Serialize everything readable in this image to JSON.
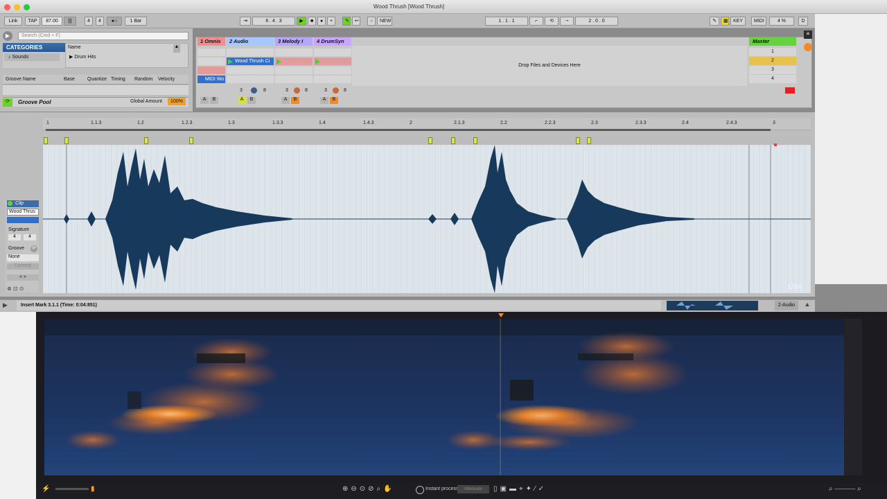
{
  "window": {
    "title": "Wood Thrush [Wood Thrush]"
  },
  "transport": {
    "link": "Link",
    "tap": "TAP",
    "tempo": "87.00",
    "signature_num": "4",
    "signature_den": "4",
    "quant": "1 Bar",
    "position": "6 . 4 . 3",
    "new": "NEW",
    "loop_start": "1 . 1 . 1",
    "loop_len": "2 . 0 . 0",
    "key": "KEY",
    "midi": "MIDI",
    "cpu": "4 %",
    "d": "D"
  },
  "browser": {
    "search_placeholder": "Search (Cmd + F)",
    "categories_label": "CATEGORIES",
    "sounds": "Sounds",
    "name_col": "Name",
    "drum_hits": "Drum Hits"
  },
  "groove": {
    "headers": [
      "Groove Name",
      "Base",
      "Quantize",
      "Timing",
      "Random",
      "Velocity"
    ],
    "pool": "Groove Pool",
    "global_amount_label": "Global Amount",
    "global_amount": "100%"
  },
  "session": {
    "tracks": [
      {
        "name": "1 Omnis",
        "color": "#ee8e8e"
      },
      {
        "name": "2 Audio",
        "color": "#a4c8ff"
      },
      {
        "name": "3 Melody I",
        "color": "#b7a6ff"
      },
      {
        "name": "4 DrumSyn",
        "color": "#c8a6ff"
      }
    ],
    "clip_wood": "Wood Thrush Ci",
    "clip_midi": "MIDI Wo",
    "drop_text": "Drop Files and Devices Here",
    "master": "Master",
    "scenes": [
      "1",
      "2",
      "3",
      "4"
    ],
    "track_num": "3",
    "sends": [
      "8"
    ],
    "ab": [
      "A",
      "B"
    ]
  },
  "ruler": {
    "ticks": [
      "1",
      "1.1.3",
      "1.2",
      "1.2.3",
      "1.3",
      "1.3.3",
      "1.4",
      "1.4.3",
      "2",
      "2.1.3",
      "2.2",
      "2.2.3",
      "2.3",
      "2.3.3",
      "2.4",
      "2.4.3",
      "3"
    ]
  },
  "clip": {
    "label": "Clip",
    "name": "Wood Thrus",
    "signature": "Signature",
    "sig_num": "4",
    "sig_den": "4",
    "groove": "Groove",
    "groove_val": "None",
    "commit": "Commit",
    "zoom": "1/64"
  },
  "status": {
    "text": "Insert Mark 3.1.1 (Time: 0:04:851)",
    "track": "2-Audio"
  },
  "rx": {
    "process": "Instant process",
    "attenuate": "Attenuate"
  }
}
